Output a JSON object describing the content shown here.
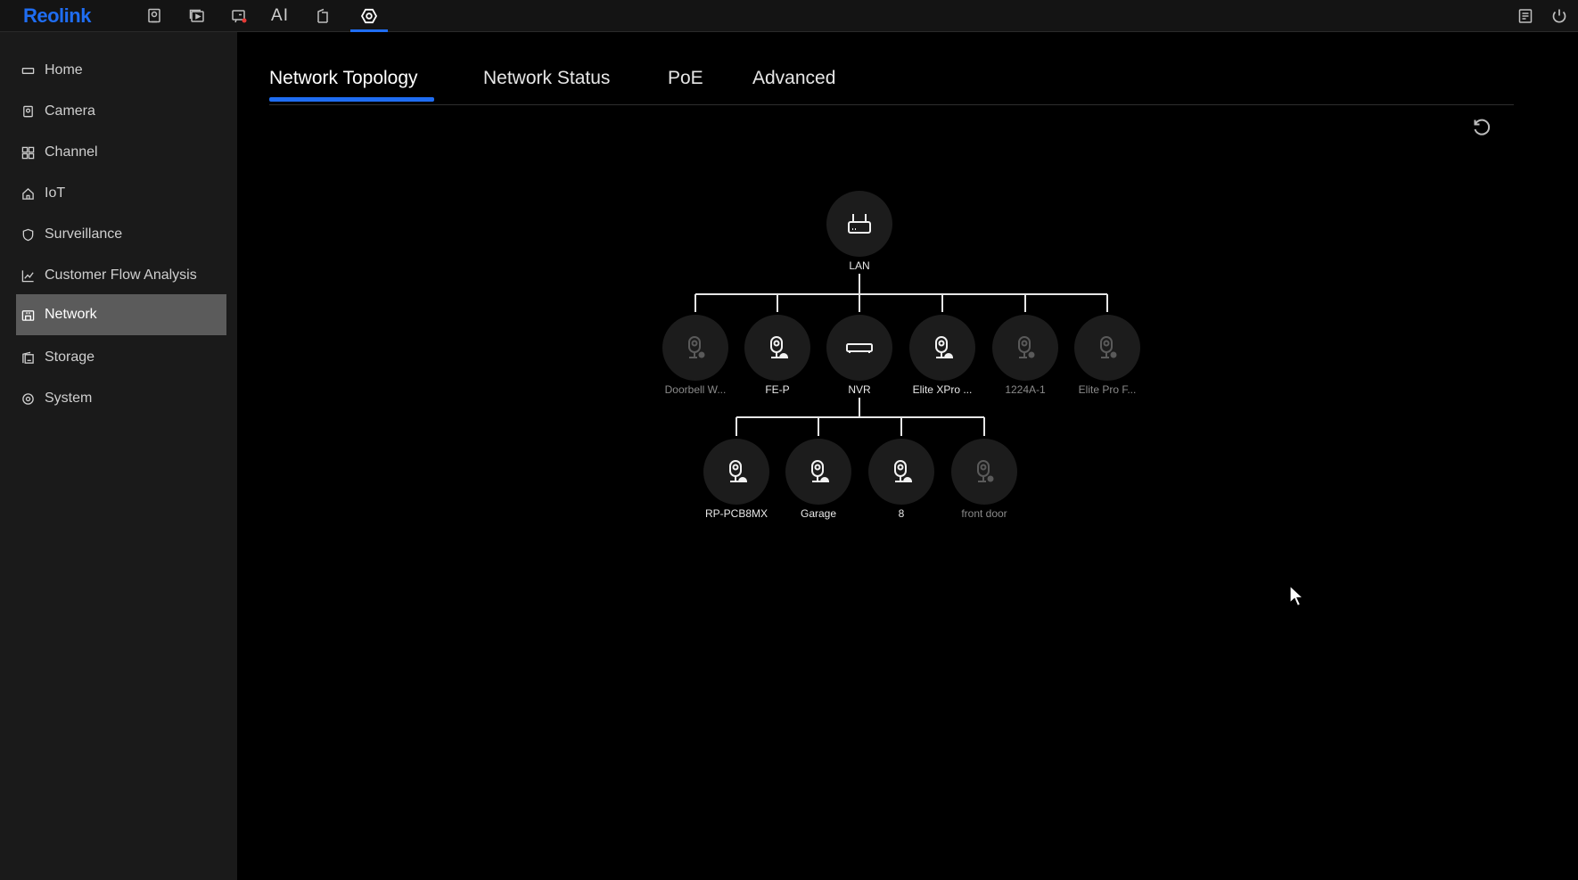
{
  "app": {
    "logo": "Reolink"
  },
  "topbar": {
    "icons": [
      "live-view-icon",
      "playback-icon",
      "alarm-icon",
      "ai-icon",
      "file-icon",
      "settings-icon"
    ],
    "ai_label": "AI",
    "right_icons": [
      "notes-icon",
      "power-icon"
    ]
  },
  "sidebar": {
    "items": [
      {
        "label": "Home",
        "icon": "home-icon"
      },
      {
        "label": "Camera",
        "icon": "camera-icon"
      },
      {
        "label": "Channel",
        "icon": "channel-icon"
      },
      {
        "label": "IoT",
        "icon": "iot-icon"
      },
      {
        "label": "Surveillance",
        "icon": "shield-icon"
      },
      {
        "label": "Customer Flow Analysis",
        "icon": "chart-icon"
      },
      {
        "label": "Network",
        "icon": "network-icon",
        "active": true
      },
      {
        "label": "Storage",
        "icon": "storage-icon"
      },
      {
        "label": "System",
        "icon": "system-icon"
      }
    ]
  },
  "tabs": [
    {
      "label": "Network Topology",
      "active": true
    },
    {
      "label": "Network Status"
    },
    {
      "label": "PoE"
    },
    {
      "label": "Advanced"
    }
  ],
  "topology": {
    "root": {
      "label": "LAN",
      "type": "router"
    },
    "level1": [
      {
        "label": "Doorbell W...",
        "type": "camera",
        "status": "offline"
      },
      {
        "label": "FE-P",
        "type": "camera",
        "status": "online"
      },
      {
        "label": "NVR",
        "type": "nvr",
        "status": "online"
      },
      {
        "label": "Elite XPro ...",
        "type": "camera",
        "status": "online"
      },
      {
        "label": "1224A-1",
        "type": "camera",
        "status": "offline"
      },
      {
        "label": "Elite Pro F...",
        "type": "camera",
        "status": "offline"
      }
    ],
    "level2": [
      {
        "label": "RP-PCB8MX",
        "type": "camera",
        "status": "online"
      },
      {
        "label": "Garage",
        "type": "camera",
        "status": "online"
      },
      {
        "label": "8",
        "type": "camera",
        "status": "online"
      },
      {
        "label": "front door",
        "type": "camera",
        "status": "offline"
      }
    ]
  },
  "colors": {
    "accent": "#1f6df2",
    "sidebar_active": "#5b5b5b"
  }
}
